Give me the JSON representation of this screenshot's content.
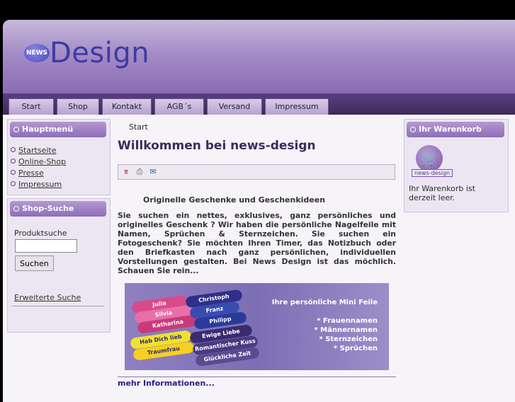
{
  "logo": {
    "badge": "NEWS",
    "wordmark": "Design"
  },
  "nav": {
    "tabs": [
      {
        "label": "Start"
      },
      {
        "label": "Shop"
      },
      {
        "label": "Kontakt"
      },
      {
        "label": "AGB´s"
      },
      {
        "label": "Versand"
      },
      {
        "label": "Impressum"
      }
    ]
  },
  "sidebar": {
    "main_menu": {
      "title": "Hauptmenü",
      "items": [
        {
          "label": "Startseite"
        },
        {
          "label": "Online-Shop"
        },
        {
          "label": "Presse"
        },
        {
          "label": "Impressum"
        }
      ]
    },
    "search": {
      "title": "Shop-Suche",
      "product_label": "Produktsuche",
      "input_value": "",
      "button_label": "Suchen",
      "advanced_link": "Erweiterte Suche"
    }
  },
  "breadcrumb": "Start",
  "main": {
    "title": "Willkommen bei news-design",
    "subtitle": "Originelle Geschenke und Geschenkideen",
    "paragraph": "Sie suchen ein nettes, exklusives, ganz persönliches und originelles Geschenk ? Wir haben die persönliche Nagelfeile mit Namen, Sprüchen & Sternzeichen. Sie suchen ein Fotogeschenk? Sie möchten Ihren Timer, das Notizbuch oder den Briefkasten nach ganz persönlichen, individuellen Vorstellungen gestalten. Bei News Design ist das möchlich. Schauen Sie rein...",
    "banner": {
      "heading": "Ihre persönliche Mini Feile",
      "list": [
        "*  Frauennamen",
        "*  Männernamen",
        "*  Sternzeichen",
        "*  Sprüchen"
      ],
      "keys": [
        "Julia",
        "Silvia",
        "Katharina",
        "Christoph",
        "Franz",
        "Philipp",
        "Hab Dich lieb",
        "Traumfrau",
        "Ewige Liebe",
        "Romantischer Kuss",
        "Glückliche Zeit"
      ]
    },
    "more_link": "mehr Informationen..."
  },
  "cart": {
    "title": "Ihr Warenkorb",
    "logo_caption": "news-design",
    "empty_text": "Ihr Warenkorb ist derzeit leer."
  },
  "colors": {
    "header": "#a48cc6",
    "nav": "#3d2a58",
    "accent": "#8e6db8",
    "title": "#3a2d5c"
  },
  "icons": [
    "pdf-icon",
    "print-icon",
    "email-icon",
    "cart-icon"
  ]
}
